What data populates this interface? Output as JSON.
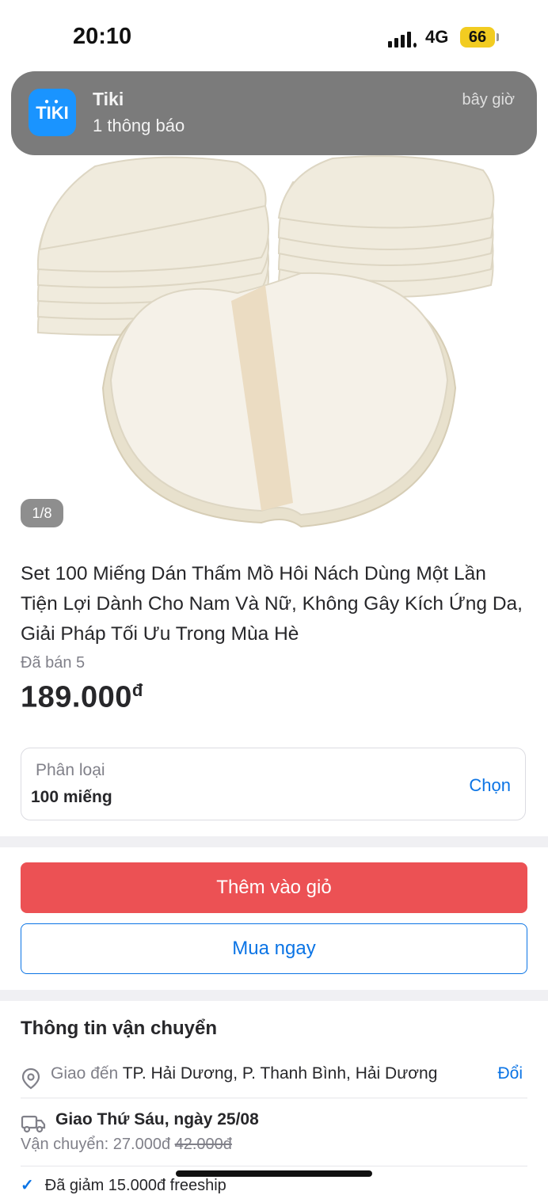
{
  "status_bar": {
    "time": "20:10",
    "network": "4G",
    "battery": "66"
  },
  "notification": {
    "app_icon_text": "TIKI",
    "app": "Tiki",
    "body": "1 thông báo",
    "time": "bây giờ"
  },
  "gallery": {
    "counter": "1/8"
  },
  "product": {
    "title": "Set 100 Miếng Dán Thấm Mồ Hôi Nách Dùng Một Lần Tiện Lợi Dành Cho Nam Và Nữ, Không Gây Kích Ứng Da, Giải Pháp Tối Ưu Trong Mùa Hè",
    "sold": "Đã bán 5",
    "price": "189.000",
    "currency": "đ"
  },
  "variant": {
    "label": "Phân loại",
    "value": "100 miếng",
    "action": "Chọn"
  },
  "actions": {
    "add_to_cart": "Thêm vào giỏ",
    "buy_now": "Mua ngay"
  },
  "shipping": {
    "title": "Thông tin vận chuyển",
    "deliver_label": "Giao đến",
    "address": "TP. Hải Dương, P. Thanh Bình, Hải Dương",
    "change": "Đổi",
    "delivery_date": "Giao Thứ Sáu, ngày 25/08",
    "fee_label": "Vận chuyển:",
    "fee": "27.000đ",
    "fee_original": "42.000đ",
    "discount": "Đã giảm 15.000đ freeship"
  },
  "colors": {
    "accent_blue": "#0b74e5",
    "cart_red": "#ec5154",
    "battery": "#f2cc21"
  }
}
